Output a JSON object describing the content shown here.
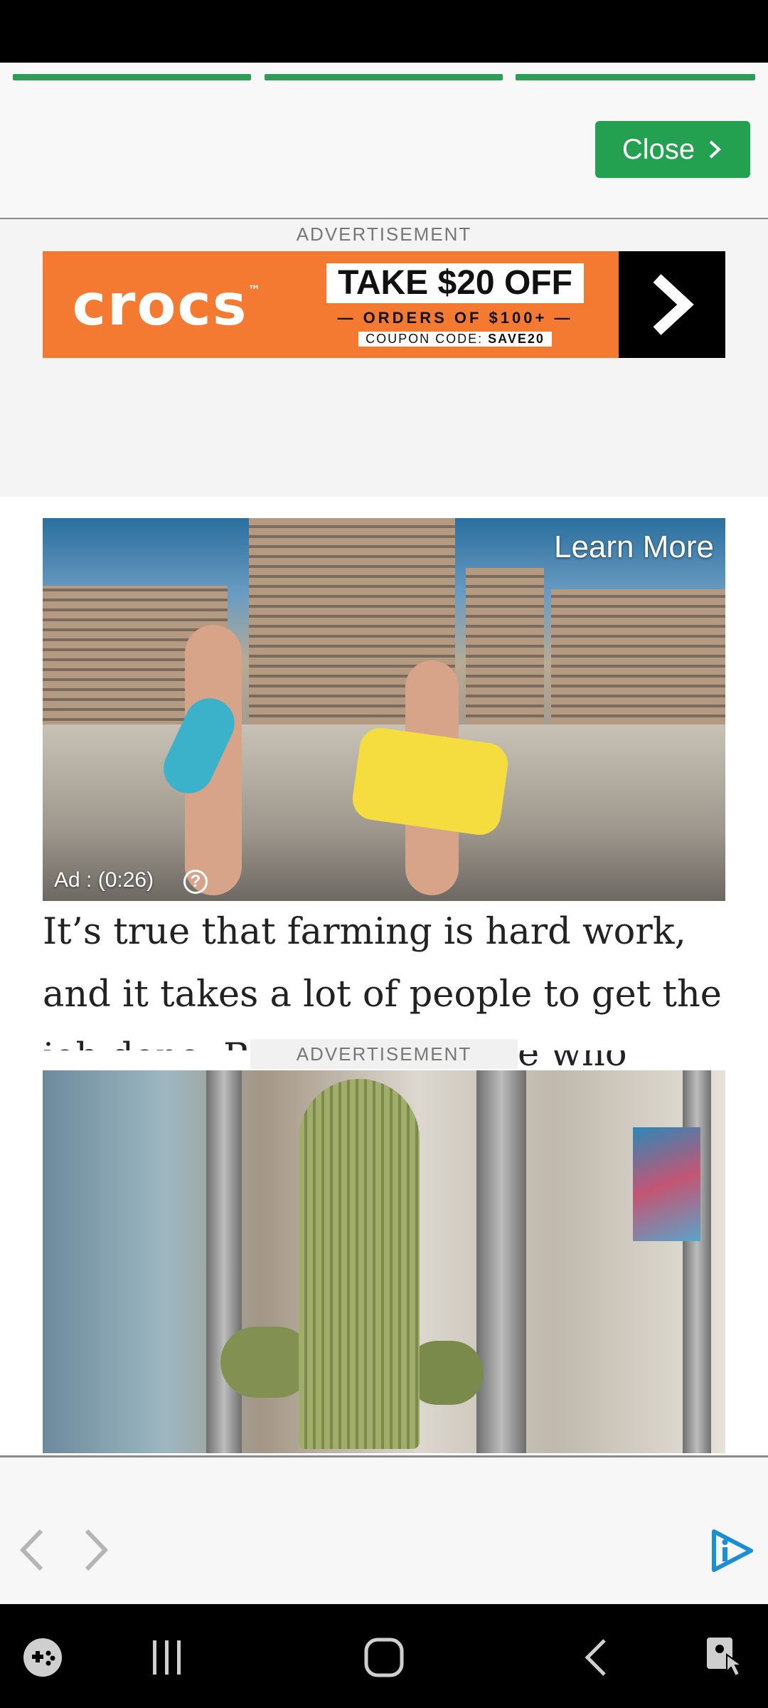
{
  "story": {
    "progress_segments": 3,
    "close_label": "Close"
  },
  "ad_top": {
    "label": "ADVERTISEMENT",
    "brand": "crocs",
    "brand_mark": "™",
    "offer": "TAKE $20 OFF",
    "offer_sub": "— ORDERS OF $100+ —",
    "coupon_prefix": "COUPON CODE:",
    "coupon_code": "SAVE20"
  },
  "video_ad": {
    "learn_more": "Learn More",
    "timer": "Ad : (0:26)",
    "help_glyph": "?"
  },
  "article": {
    "text": "It’s true that farming is hard work, and it takes a lot of people to get the job done. But th",
    "text_tail": "e who work"
  },
  "ad_inline": {
    "label": "ADVERTISEMENT"
  },
  "icons": {
    "nav_prev": "chevron-left-icon",
    "nav_next": "chevron-right-icon",
    "brand": "play-info-icon",
    "system": [
      "game-launcher-icon",
      "recents-icon",
      "home-icon",
      "back-icon",
      "accessibility-icon"
    ]
  },
  "colors": {
    "accent_green": "#23a150",
    "crocs_orange": "#f47a31",
    "brand_blue": "#1a8fd6"
  }
}
